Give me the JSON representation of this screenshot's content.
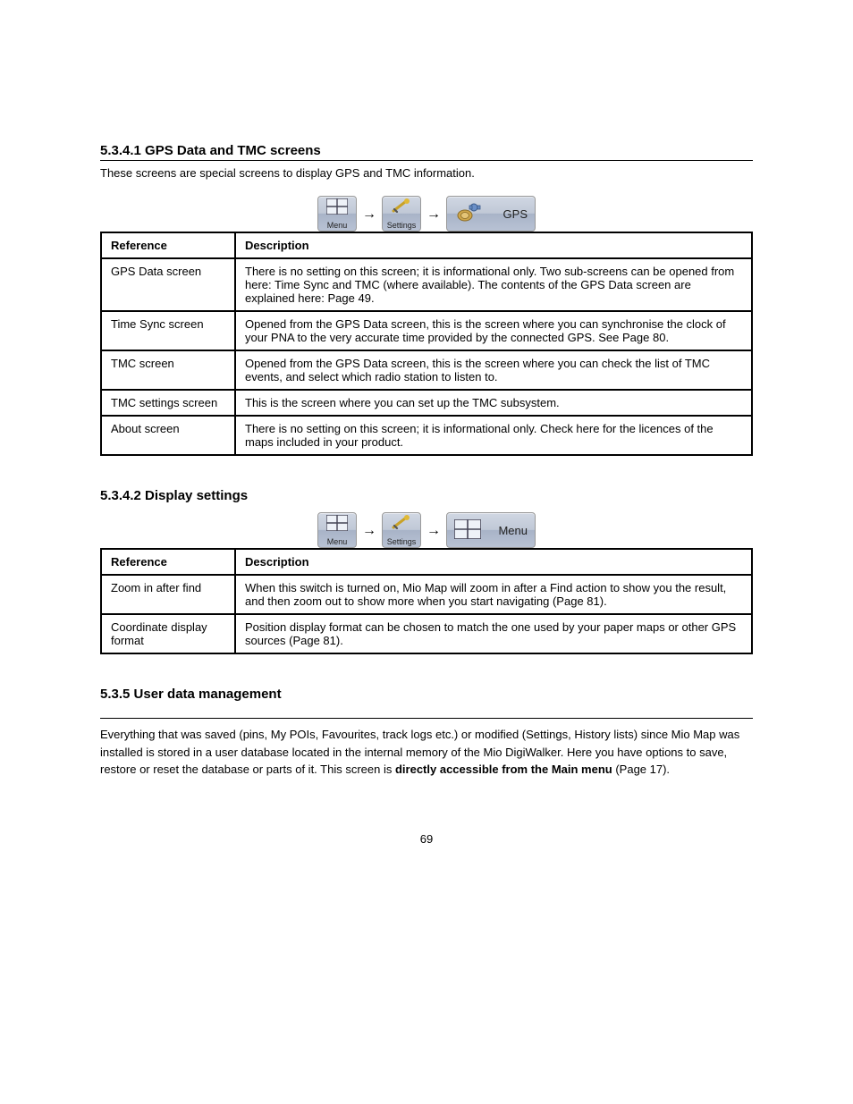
{
  "section1": {
    "title": "5.3.4.1 GPS Data and TMC screens",
    "desc": "These screens are special screens to display GPS and TMC information.",
    "breadcrumb": {
      "menu": "Menu",
      "settings": "Settings",
      "gps": "GPS"
    },
    "table": {
      "header_left": "Reference",
      "header_right": "Description",
      "rows": [
        {
          "left": "GPS Data screen",
          "right": "There is no setting on this screen; it is informational only. Two sub-screens can be opened from here: Time Sync and TMC (where available). The contents of the GPS Data screen are explained here: Page 49."
        },
        {
          "left": "Time Sync screen",
          "right": "Opened from the GPS Data screen, this is the screen where you can synchronise the clock of your PNA to the very accurate time provided by the connected GPS. See Page 80."
        },
        {
          "left": "TMC screen",
          "right": "Opened from the GPS Data screen, this is the screen where you can check the list of TMC events, and select which radio station to listen to."
        },
        {
          "left": "TMC settings screen",
          "right": "This is the screen where you can set up the TMC subsystem."
        },
        {
          "left": "About screen",
          "right": "There is no setting on this screen; it is informational only. Check here for the licences of the maps included in your product."
        }
      ]
    }
  },
  "section2": {
    "title": "5.3.4.2 Display settings",
    "breadcrumb": {
      "menu": "Menu",
      "settings": "Settings",
      "display": "Menu"
    },
    "table": {
      "header_left": "Reference",
      "header_right": "Description",
      "rows": [
        {
          "left": "Zoom in after find",
          "right": "When this switch is turned on, Mio Map will zoom in after a Find action to show you the result, and then zoom out to show more when you start navigating (Page 81)."
        },
        {
          "left": "Coordinate display format",
          "right": "Position display format can be chosen to match the one used by your paper maps or other GPS sources (Page 81)."
        }
      ]
    }
  },
  "footer": {
    "heading": "5.3.5 User data management",
    "text_before": "Everything that was saved (pins, My POIs, Favourites, track logs etc.) or modified (Settings, History lists) since Mio Map was installed is stored in a user database located in the internal memory of the Mio DigiWalker. Here you have options to save, restore or reset the database or parts of it. This screen is ",
    "bold_ref": "directly accessible from the Main menu",
    "text_after": " (Page 17)."
  },
  "page_number": "69"
}
